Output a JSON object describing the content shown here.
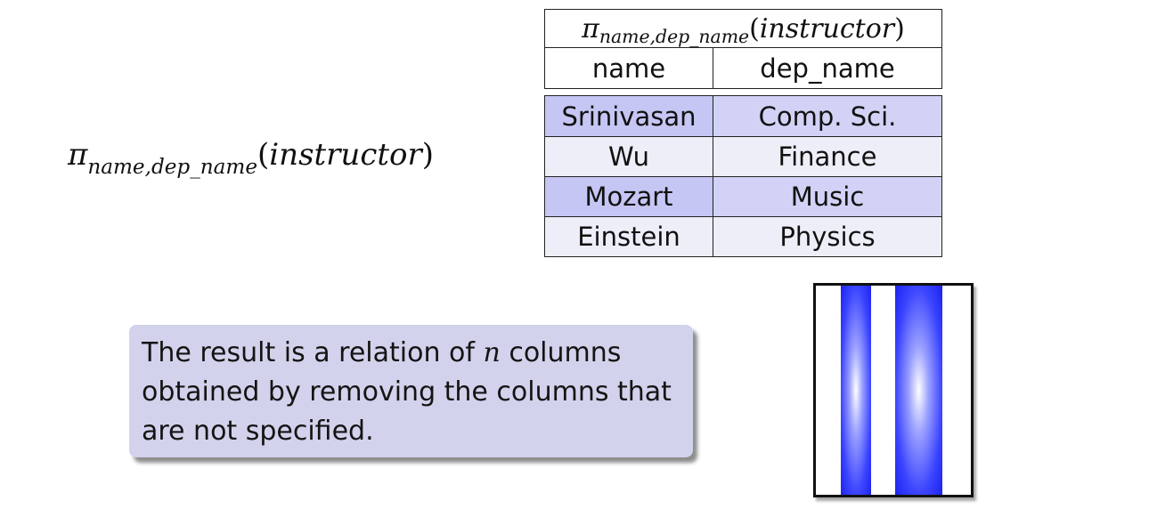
{
  "expression": {
    "symbol": "π",
    "subscript": "name,dep_name",
    "relation": "instructor"
  },
  "table": {
    "title": {
      "symbol": "π",
      "subscript": "name,dep_name",
      "relation": "instructor"
    },
    "headers": [
      "name",
      "dep_name"
    ],
    "rows": [
      [
        "Srinivasan",
        "Comp. Sci."
      ],
      [
        "Wu",
        "Finance"
      ],
      [
        "Mozart",
        "Music"
      ],
      [
        "Einstein",
        "Physics"
      ]
    ]
  },
  "note": {
    "before": "The result is a relation of ",
    "variable": "n",
    "after": " columns obtained by removing the columns that are not specified."
  },
  "colors": {
    "highlight_row": "#c6c6f4",
    "plain_row": "#eeeef8",
    "note_background": "#d2d2ec",
    "stripe": "#1a22ee"
  }
}
